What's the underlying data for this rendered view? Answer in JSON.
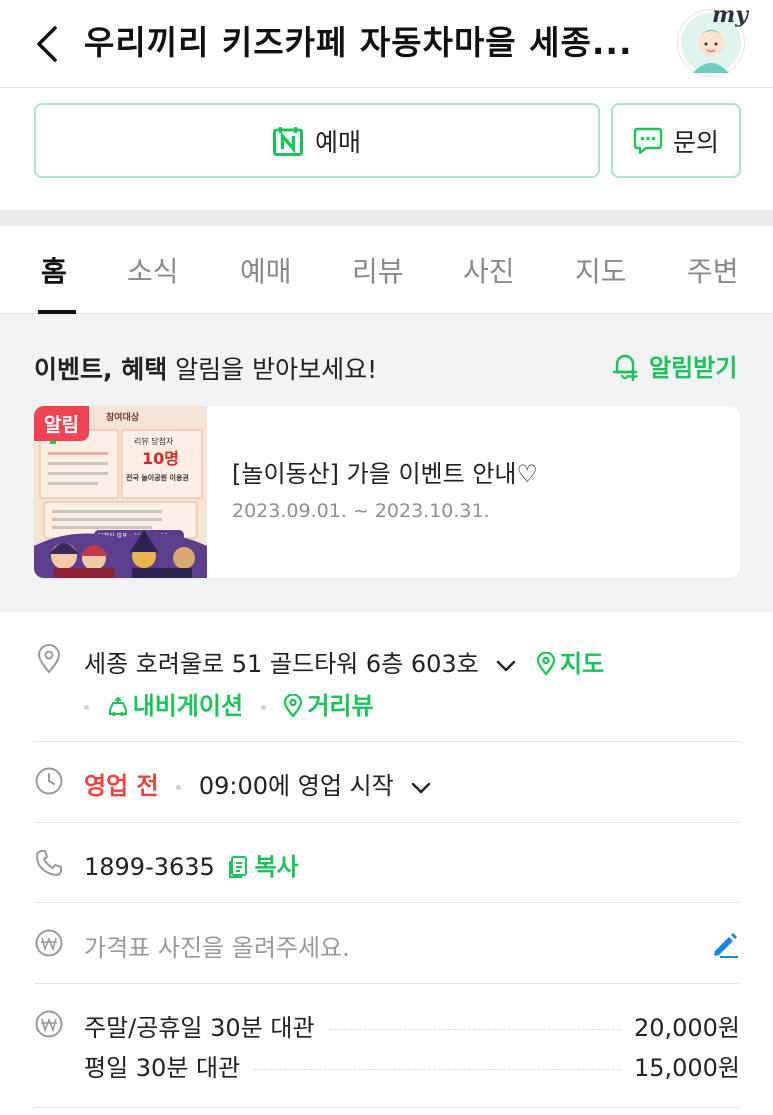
{
  "header": {
    "title": "우리끼리 키즈카페 자동차마을 세종...",
    "avatar_label": "my"
  },
  "actions": {
    "reserve_label": "예매",
    "inquiry_label": "문의"
  },
  "tabs": [
    {
      "label": "홈",
      "active": true
    },
    {
      "label": "소식",
      "active": false
    },
    {
      "label": "예매",
      "active": false
    },
    {
      "label": "리뷰",
      "active": false
    },
    {
      "label": "사진",
      "active": false
    },
    {
      "label": "지도",
      "active": false
    },
    {
      "label": "주변",
      "active": false
    }
  ],
  "event": {
    "heading_bold": "이벤트, 혜택",
    "heading_rest": " 알림을 받아보세요!",
    "alarm_label": "알림받기",
    "card": {
      "badge": "알림",
      "title": "[놀이동산] 가을 이벤트 안내♡",
      "date": "2023.09.01. ~ 2023.10.31.",
      "thumb_texts": {
        "line1": "참여대상",
        "count_label": "리뷰 당첨자",
        "count": "10명",
        "prize": "전국 놀이공원 이용권",
        "announce": "당첨자 발표 : 2023.11.06"
      }
    }
  },
  "info": {
    "address": "세종 호려울로 51 골드타워 6층 603호",
    "map_label": "지도",
    "navigation_label": "내비게이션",
    "streetview_label": "거리뷰",
    "status": "영업 전",
    "hours": "09:00에 영업 시작",
    "phone": "1899-3635",
    "copy_label": "복사",
    "price_prompt": "가격표 사진을 올려주세요.",
    "prices": [
      {
        "name": "주말/공휴일 30분 대관",
        "price": "20,000원"
      },
      {
        "name": "평일 30분 대관",
        "price": "15,000원"
      }
    ]
  },
  "colors": {
    "accent_green": "#1ec25a",
    "status_red": "#e8463f",
    "button_border": "#aee6c6",
    "badge_red": "#f04452",
    "edit_blue": "#1a86e0"
  },
  "icons": [
    "back-arrow-icon",
    "naver-n-icon",
    "chat-bubble-icon",
    "bell-plus-icon",
    "location-pin-icon",
    "chevron-down-icon",
    "navigation-icon",
    "clock-icon",
    "phone-icon",
    "copy-icon",
    "won-icon",
    "pencil-icon"
  ]
}
